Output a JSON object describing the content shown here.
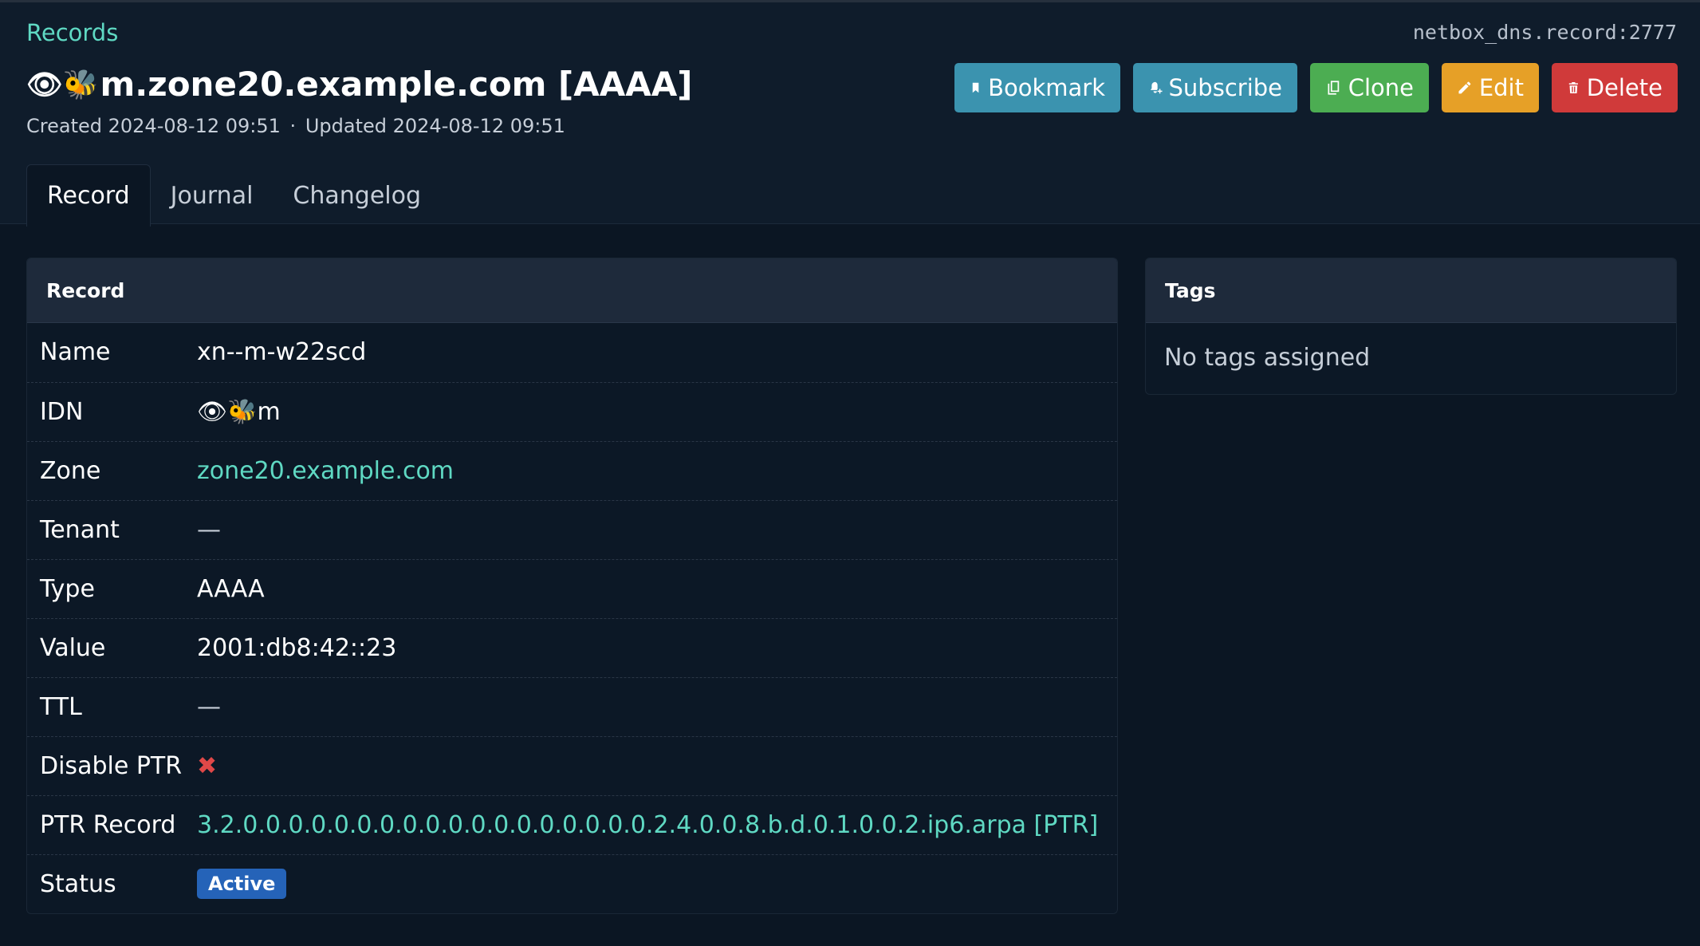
{
  "breadcrumb": "Records",
  "object_id": "netbox_dns.record:2777",
  "title": {
    "emoji": "👁🐝",
    "text": "m.zone20.example.com [AAAA]"
  },
  "meta": {
    "created_label": "Created",
    "created": "2024-08-12 09:51",
    "separator": "·",
    "updated_label": "Updated",
    "updated": "2024-08-12 09:51"
  },
  "actions": {
    "bookmark": "Bookmark",
    "subscribe": "Subscribe",
    "clone": "Clone",
    "edit": "Edit",
    "delete": "Delete"
  },
  "tabs": [
    {
      "label": "Record",
      "active": true
    },
    {
      "label": "Journal",
      "active": false
    },
    {
      "label": "Changelog",
      "active": false
    }
  ],
  "record": {
    "heading": "Record",
    "rows": [
      {
        "label": "Name",
        "value": "xn--m-w22scd"
      },
      {
        "label": "IDN",
        "value": "👁🐝m"
      },
      {
        "label": "Zone",
        "value": "zone20.example.com"
      },
      {
        "label": "Tenant",
        "value": "—"
      },
      {
        "label": "Type",
        "value": "AAAA"
      },
      {
        "label": "Value",
        "value": "2001:db8:42::23"
      },
      {
        "label": "TTL",
        "value": "—"
      },
      {
        "label": "Disable PTR",
        "value": "✖"
      },
      {
        "label": "PTR Record",
        "value": "3.2.0.0.0.0.0.0.0.0.0.0.0.0.0.0.0.0.0.0.2.4.0.0.8.b.d.0.1.0.0.2.ip6.arpa [PTR]"
      },
      {
        "label": "Status",
        "value": "Active"
      }
    ]
  },
  "tags": {
    "heading": "Tags",
    "empty": "No tags assigned"
  },
  "colors": {
    "accent": "#5fd9c3",
    "bookmark": "#3b93af",
    "subscribe": "#3b93af",
    "clone": "#4cad52",
    "edit": "#e6a027",
    "delete": "#d03a3a",
    "status_active": "#2563b8"
  },
  "icons": {
    "bookmark": "bookmark-icon",
    "subscribe": "bell-plus-icon",
    "clone": "copy-icon",
    "edit": "pencil-icon",
    "delete": "trash-icon",
    "disable_ptr": "x-mark-icon"
  }
}
